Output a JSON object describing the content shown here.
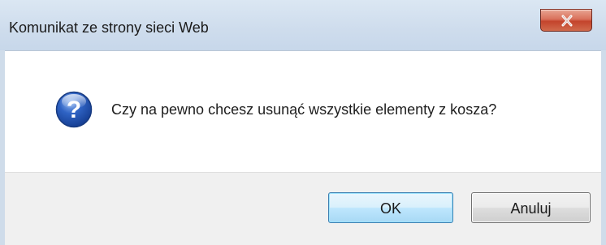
{
  "window": {
    "title": "Komunikat ze strony sieci Web",
    "close_glyph": "x"
  },
  "dialog": {
    "icon": "question-icon",
    "message": "Czy na pewno chcesz usunąć wszystkie elementy z kosza?"
  },
  "buttons": {
    "ok_label": "OK",
    "cancel_label": "Anuluj"
  },
  "colors": {
    "titlebar": "#cfdcea",
    "close_button": "#c94a33",
    "content_background": "#ffffff",
    "button_bar": "#f0f0f0",
    "default_button_border": "#3c7fb1",
    "question_icon": "#1f4fa8"
  }
}
